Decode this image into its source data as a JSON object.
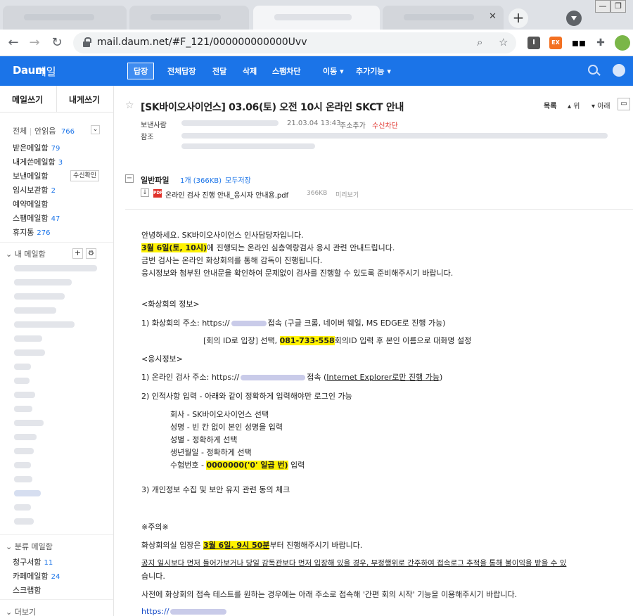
{
  "browser": {
    "url": "mail.daum.net/#F_121/000000000000Uvv",
    "new_tab": "+",
    "ext_i": "I",
    "ext_ex": "EX"
  },
  "daum": {
    "logo": "Daum",
    "logo_sub": "메일",
    "nav": [
      "답장",
      "전체답장",
      "전달",
      "삭제",
      "스팸차단",
      "이동",
      "추가기능"
    ]
  },
  "sidebar": {
    "compose": "메일쓰기",
    "compose_self": "내게쓰기",
    "all_label": "전체",
    "unread_label": "안읽음",
    "unread_count": "766",
    "items": [
      {
        "label": "받은메일함",
        "count": "79"
      },
      {
        "label": "내게쓴메일함",
        "count": "3"
      },
      {
        "label": "보낸메일함",
        "count": ""
      },
      {
        "label": "임시보관함",
        "count": "2"
      },
      {
        "label": "예약메일함",
        "count": ""
      },
      {
        "label": "스팸메일함",
        "count": "47"
      },
      {
        "label": "휴지통",
        "count": "276"
      }
    ],
    "receipt_btn": "수신확인",
    "my_mailbox": "내 메일함",
    "category_head": "분류 메일함",
    "category_items": [
      {
        "label": "청구서함",
        "count": "11"
      },
      {
        "label": "카페메일함",
        "count": "24"
      },
      {
        "label": "스크랩함",
        "count": ""
      }
    ],
    "more": "더보기"
  },
  "mail": {
    "subject": "[SK바이오사이언스] 03.06(토) 오전 10시 온라인 SKCT 안내",
    "list_btn": "목록",
    "up_btn": "위",
    "down_btn": "아래",
    "sender_label": "보낸사람",
    "date": "21.03.04 13:43",
    "add_addr": "주소추가",
    "block": "수신차단",
    "cc_label": "참조",
    "attach_title": "일반파일",
    "attach_count": "1개 (366KB)",
    "save_all": "모두저장",
    "file_name": "온라인 검사 진행 안내_응시자 안내용.pdf",
    "file_size": "366KB",
    "preview": "미리보기",
    "body": {
      "l1": "안녕하세요. SK바이오사이언스 인사담당자입니다.",
      "l2_hl": "3월 6일(토, 10시)",
      "l2_rest": "에 진행되는 온라인 심층역량검사 응시 관련 안내드립니다.",
      "l3": "금번 검사는 온라인 화상회의를 통해 감독이 진행됩니다.",
      "l4": "응시정보와 첨부된 안내문을 확인하여 문제없이 검사를 진행할 수 있도록 준비해주시기 바랍니다.",
      "s1": "<화상회의 정보>",
      "v1_pre": "1) 화상회의 주소: https://",
      "v1_post": "접속 (구글 크롬, 네이버 웨일, MS EDGE로 진행 가능)",
      "v2_pre": "[회의 ID로 입장] 선택, ",
      "v2_hl": "081-733-558",
      "v2_post": "회의ID 입력 후 본인 이름으로 대화명 설정",
      "s2": "<응시정보>",
      "t1_pre": "1) 온라인 검사 주소: https://",
      "t1_mid": "접속 (",
      "t1_ul": "Internet Explorer로만 진행 가능",
      "t1_post": ")",
      "t2": "2) 인적사항 입력 - 아래와 같이 정확하게 입력해야만 로그인 가능",
      "f1": "회사 - SK바이오사이언스 선택",
      "f2": "성명 - 빈 칸 없이 본인 성명을 입력",
      "f3": "성별 - 정확하게 선택",
      "f4": "생년월일 - 정확하게 선택",
      "f5_pre": "수험번호 - ",
      "f5_hl": "0000000('0' 일곱 번)",
      "f5_post": " 입력",
      "t3": "3) 개인정보 수집 및 보안 유지 관련 동의 체크",
      "warn": "※주의※",
      "w1_pre": "화상회의실 입장은 ",
      "w1_hl": "3월 6일, 9시 50분",
      "w1_post": "부터 진행해주시기 바랍니다.",
      "w2a": "공지 일시보다 먼저 들어가보거나 당일 감독관보다 먼저 입장해 있을 경우, 부정행위로 간주하여 접속로그 추적을 통해 불이익을 받을 수 있",
      "w2b": "습니다.",
      "w3": "사전에 화상회의 접속 테스트를 원하는 경우에는 아래 주소로 접속해 '간편 회의 시작' 기능을 이용해주시기 바랍니다.",
      "w4": "https://"
    }
  }
}
